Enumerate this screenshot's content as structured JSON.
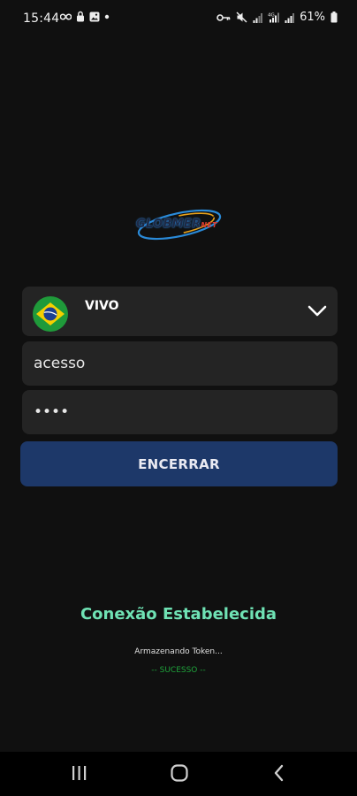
{
  "status_bar": {
    "time": "15:44",
    "battery_percent": "61%",
    "left_icons": [
      "infinity-icon",
      "lock-icon",
      "image-icon",
      "dot-icon"
    ],
    "right_icons": [
      "vpn-key-icon",
      "mute-icon",
      "signal-icon",
      "lte-signal-icon",
      "signal-icon",
      "battery-icon"
    ]
  },
  "logo": {
    "text": "GLOBMER",
    "suffix": "NET"
  },
  "operator": {
    "label": "VIVO",
    "flag": "brazil-flag"
  },
  "login": {
    "user_value": "acesso",
    "password_value": "••••"
  },
  "action_button": {
    "label": "ENCERRAR"
  },
  "status": {
    "main": "Conexão Estabelecida",
    "sub": "Armazenando Token...",
    "result": "-- SUCESSO --"
  },
  "colors": {
    "background": "#101010",
    "card": "#242424",
    "button": "#1d3869",
    "status_main": "#6fe2b4",
    "status_ok": "#1fa33b"
  },
  "navigation": [
    "recent-apps-icon",
    "home-icon",
    "back-icon"
  ]
}
